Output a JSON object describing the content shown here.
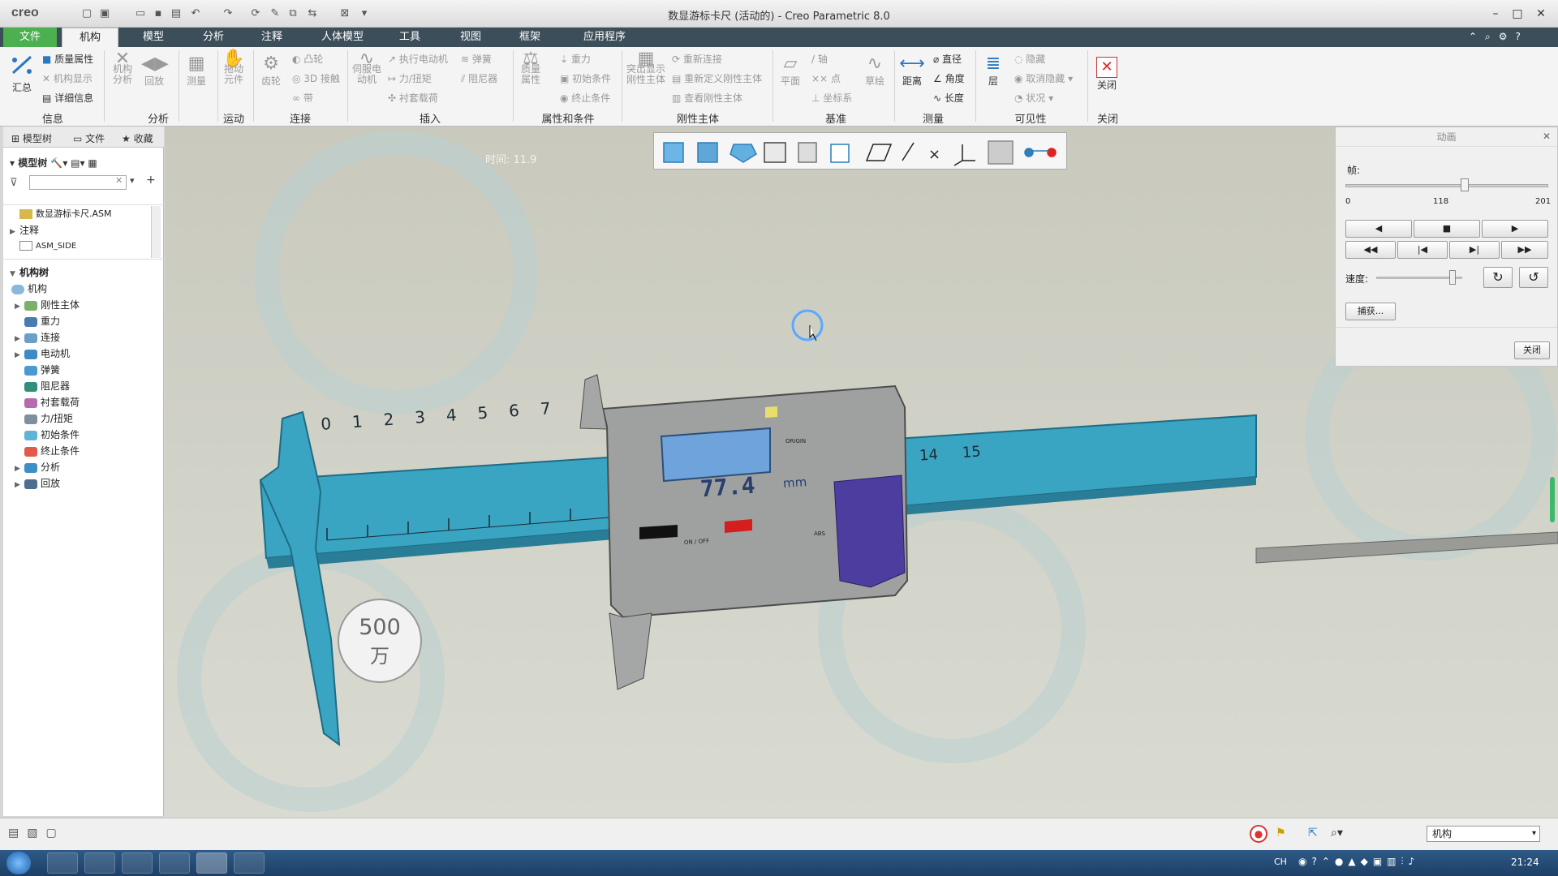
{
  "app": {
    "logo": "creo",
    "window_title": "数显游标卡尺 (活动的) - Creo Parametric 8.0"
  },
  "menu": {
    "tabs": [
      "文件",
      "机构",
      "模型",
      "分析",
      "注释",
      "人体模型",
      "工具",
      "视图",
      "框架",
      "应用程序"
    ]
  },
  "ribbon": {
    "groups": [
      {
        "label": "信息",
        "items": [
          "汇总",
          "质量属性",
          "机构显示",
          "详细信息"
        ]
      },
      {
        "label": "分析",
        "items": [
          "机构分析",
          "回放",
          "测量"
        ]
      },
      {
        "label": "运动",
        "items": [
          "拖动元件"
        ]
      },
      {
        "label": "连接",
        "items": [
          "齿轮",
          "凸轮",
          "3D 接触",
          "带"
        ]
      },
      {
        "label": "插入",
        "items": [
          "伺服电动机",
          "执行电动机",
          "力/扭矩",
          "衬套载荷",
          "弹簧",
          "阻尼器"
        ]
      },
      {
        "label": "属性和条件",
        "items": [
          "质量属性",
          "重力",
          "初始条件",
          "终止条件"
        ]
      },
      {
        "label": "刚性主体",
        "items": [
          "突出显示刚性主体",
          "重新连接",
          "重新定义刚性主体",
          "查看刚性主体"
        ]
      },
      {
        "label": "基准",
        "items": [
          "平面",
          "轴",
          "点",
          "坐标系",
          "草绘"
        ]
      },
      {
        "label": "测量",
        "items": [
          "距离",
          "直径",
          "角度",
          "长度"
        ]
      },
      {
        "label": "可见性",
        "items": [
          "层",
          "隐藏",
          "取消隐藏",
          "状况"
        ]
      },
      {
        "label": "关闭",
        "items": [
          "关闭"
        ]
      }
    ]
  },
  "left_panel": {
    "tabs": [
      "模型树",
      "文件",
      "收藏"
    ],
    "model_tree_label": "模型树",
    "top_items": [
      "数显游标卡尺.ASM",
      "注释",
      "ASM_SIDE"
    ],
    "mechanism_tree": {
      "title": "机构树",
      "root": "机构",
      "items": [
        "刚性主体",
        "重力",
        "连接",
        "电动机",
        "弹簧",
        "阻尼器",
        "衬套载荷",
        "力/扭矩",
        "初始条件",
        "终止条件",
        "分析",
        "回放"
      ]
    }
  },
  "viewport": {
    "time_label": "时间: 11.9",
    "display": {
      "value": "77.4",
      "unit": "mm",
      "origin": "ORIGIN",
      "onoff": "ON / OFF",
      "abs": "ABS"
    },
    "scale_numbers": [
      "0",
      "1",
      "2",
      "3",
      "4",
      "5",
      "6",
      "7"
    ],
    "scale_numbers_right": [
      "14",
      "15"
    ],
    "watermark": {
      "top": "500",
      "bottom": "万"
    }
  },
  "animation_panel": {
    "title": "动画",
    "frame_label": "帧:",
    "frame_min": "0",
    "frame_current": "118",
    "frame_max": "201",
    "frame_fraction": 0.587,
    "speed_label": "速度:",
    "speed_fraction": 0.92,
    "capture": "捕获...",
    "close": "关闭"
  },
  "status": {
    "mode_select": "机构"
  },
  "taskbar": {
    "lang": "CH",
    "time": "21:24"
  }
}
